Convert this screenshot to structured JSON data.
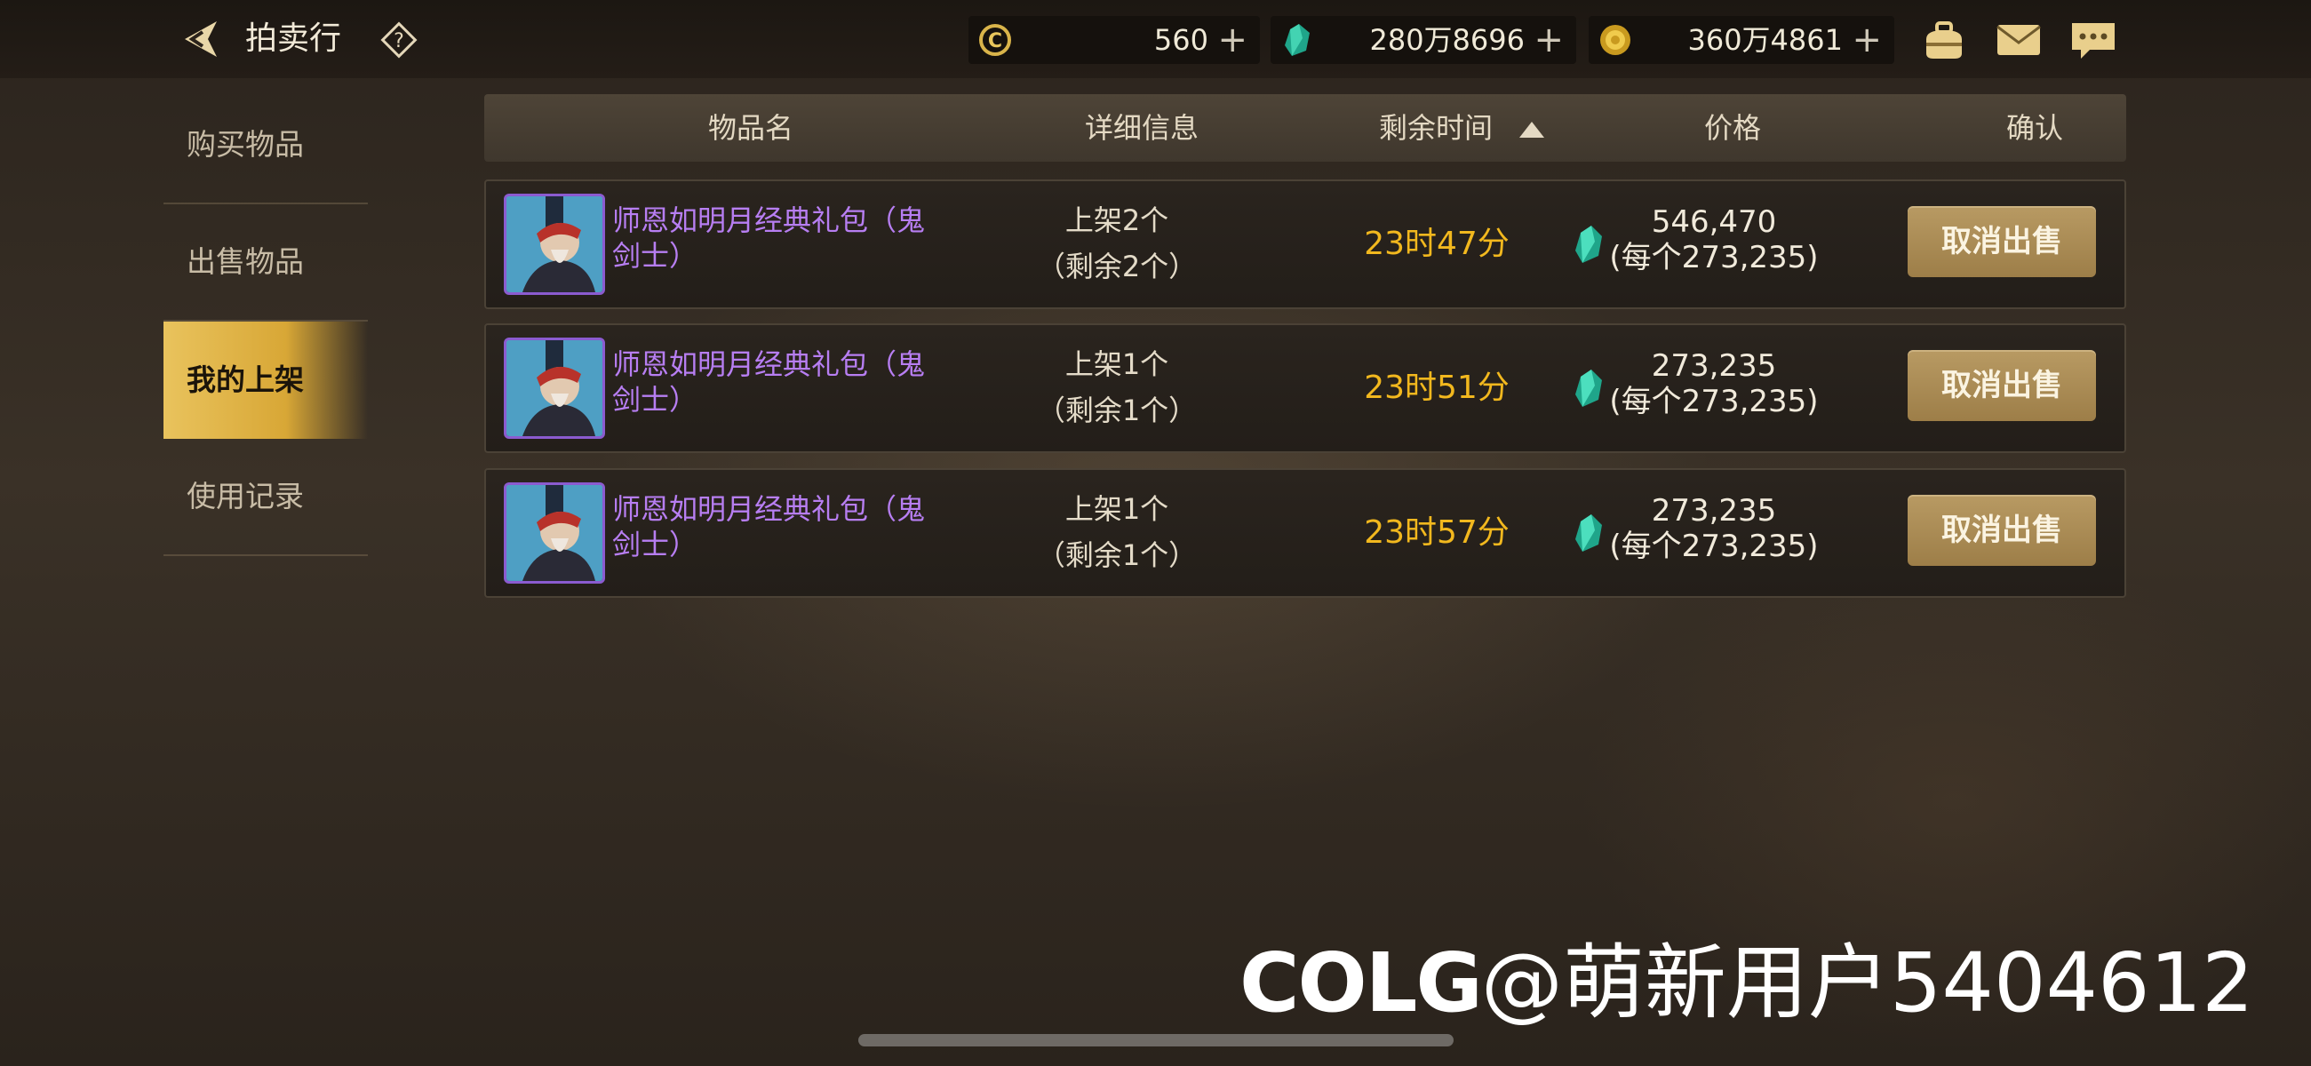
{
  "header": {
    "title": "拍卖行",
    "currencies": [
      {
        "icon": "c-coin-icon",
        "value": "560"
      },
      {
        "icon": "gem-icon",
        "value": "280万8696"
      },
      {
        "icon": "gold-coin-icon",
        "value": "360万4861"
      }
    ]
  },
  "sidebar": {
    "items": [
      {
        "label": "购买物品"
      },
      {
        "label": "出售物品"
      },
      {
        "label": "我的上架"
      },
      {
        "label": "使用记录"
      }
    ],
    "active": "我的上架"
  },
  "table": {
    "columns": [
      "物品名",
      "详细信息",
      "剩余时间",
      "价格",
      "确认"
    ],
    "sort_column": "剩余时间",
    "rows": [
      {
        "name": "师恩如明月经典礼包（鬼剑士）",
        "listed": "上架2个",
        "remaining": "（剩余2个）",
        "time": "23时47分",
        "price": "546,470",
        "unit_price": "(每个273,235)",
        "action": "取消出售"
      },
      {
        "name": "师恩如明月经典礼包（鬼剑士）",
        "listed": "上架1个",
        "remaining": "（剩余1个）",
        "time": "23时51分",
        "price": "273,235",
        "unit_price": "(每个273,235)",
        "action": "取消出售"
      },
      {
        "name": "师恩如明月经典礼包（鬼剑士）",
        "listed": "上架1个",
        "remaining": "（剩余1个）",
        "time": "23时57分",
        "price": "273,235",
        "unit_price": "(每个273,235)",
        "action": "取消出售"
      }
    ]
  },
  "watermark": {
    "logo": "COLG",
    "user": "@萌新用户5404612"
  },
  "colors": {
    "accent_gold": "#e9c35d",
    "item_purple": "#b77ef2",
    "time_orange": "#f2b81e",
    "button": "#ab8c55"
  }
}
